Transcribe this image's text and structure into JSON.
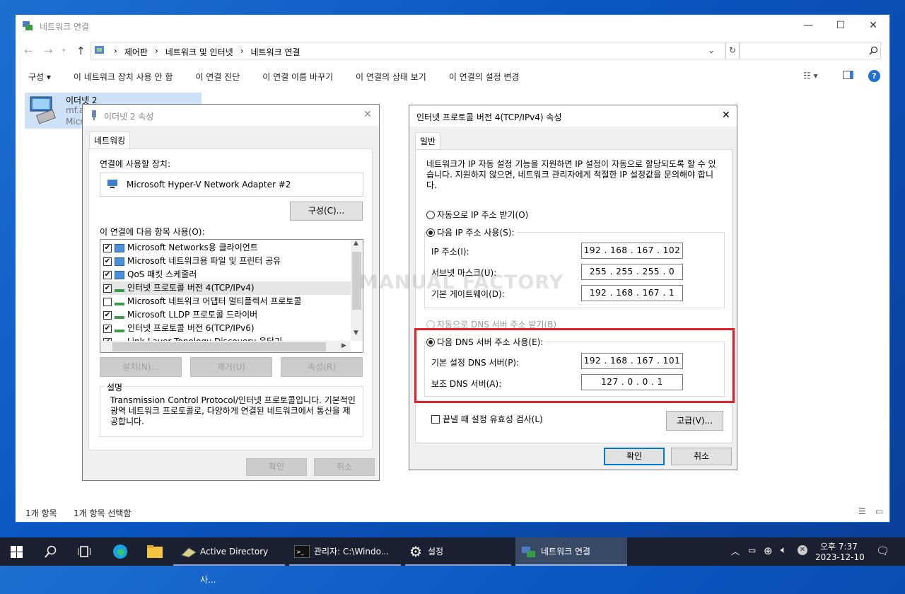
{
  "explorer": {
    "title": "네트워크 연결",
    "breadcrumb": [
      "제어판",
      "네트워크 및 인터넷",
      "네트워크 연결"
    ],
    "commands": [
      "구성 ▾",
      "이 네트워크 장치 사용 안 함",
      "이 연결 진단",
      "이 연결 이름 바꾸기",
      "이 연결의 상태 보기",
      "이 연결의 설정 변경"
    ],
    "item": {
      "name": "이더넷 2",
      "line2": "mf.a",
      "line3": "Micr"
    },
    "status": {
      "count": "1개 항목",
      "selected": "1개 항목 선택함"
    }
  },
  "props": {
    "title": "이더넷 2 속성",
    "tab": "네트워킹",
    "device_label": "연결에 사용할 장치:",
    "device": "Microsoft Hyper-V Network Adapter #2",
    "configure": "구성(C)...",
    "items_label": "이 연결에 다음 항목 사용(O):",
    "items": [
      {
        "label": "Microsoft Networks용 클라이언트",
        "checked": true
      },
      {
        "label": "Microsoft 네트워크용 파일 및 프린터 공유",
        "checked": true
      },
      {
        "label": "QoS 패킷 스케줄러",
        "checked": true
      },
      {
        "label": "인터넷 프로토콜 버전 4(TCP/IPv4)",
        "checked": true
      },
      {
        "label": "Microsoft 네트워크 어댑터 멀티플렉서 프로토콜",
        "checked": false
      },
      {
        "label": "Microsoft LLDP 프로토콜 드라이버",
        "checked": true
      },
      {
        "label": "인터넷 프로토콜 버전 6(TCP/IPv6)",
        "checked": true
      },
      {
        "label": "Link-Layer Topology Discovery 응답기",
        "checked": true
      }
    ],
    "install": "설치(N)...",
    "remove": "제거(U)",
    "properties": "속성(R)",
    "desc_title": "설명",
    "desc": "Transmission Control Protocol/인터넷 프로토콜입니다. 기본적인 광역 네트워크 프로토콜로, 다양하게 연결된 네트워크에서 통신을 제공합니다.",
    "ok": "확인",
    "cancel": "취소"
  },
  "ipv4": {
    "title": "인터넷 프로토콜 버전 4(TCP/IPv4) 속성",
    "tab": "일반",
    "intro": "네트워크가 IP 자동 설정 기능을 지원하면 IP 설정이 자동으로 할당되도록 할 수 있습니다. 지원하지 않으면, 네트워크 관리자에게 적절한 IP 설정값을 문의해야 합니다.",
    "auto_ip": "자동으로 IP 주소 받기(O)",
    "manual_ip": "다음 IP 주소 사용(S):",
    "ip_label": "IP 주소(I):",
    "ip": "192 . 168 . 167 . 102",
    "mask_label": "서브넷 마스크(U):",
    "mask": "255 . 255 . 255 .  0",
    "gw_label": "기본 게이트웨이(D):",
    "gw": "192 . 168 . 167 .  1",
    "auto_dns": "자동으로 DNS 서버 주소 받기(B)",
    "manual_dns": "다음 DNS 서버 주소 사용(E):",
    "dns1_label": "기본 설정 DNS 서버(P):",
    "dns1": "192 . 168 . 167 . 101",
    "dns2_label": "보조 DNS 서버(A):",
    "dns2": "127 .  0  .  0  .  1",
    "validate": "끝낼 때 설정 유효성 검사(L)",
    "advanced": "고급(V)...",
    "ok": "확인",
    "cancel": "취소"
  },
  "watermark": "MANUAL FACTORY",
  "taskbar": {
    "ad": "Active Directory 사...",
    "cmd": "관리자: C:\\Windo...",
    "settings": "설정",
    "net": "네트워크 연결",
    "time": "오후 7:37",
    "date": "2023-12-10"
  },
  "colors": {
    "highlight": "#e0222b",
    "accent": "#0078d7"
  }
}
